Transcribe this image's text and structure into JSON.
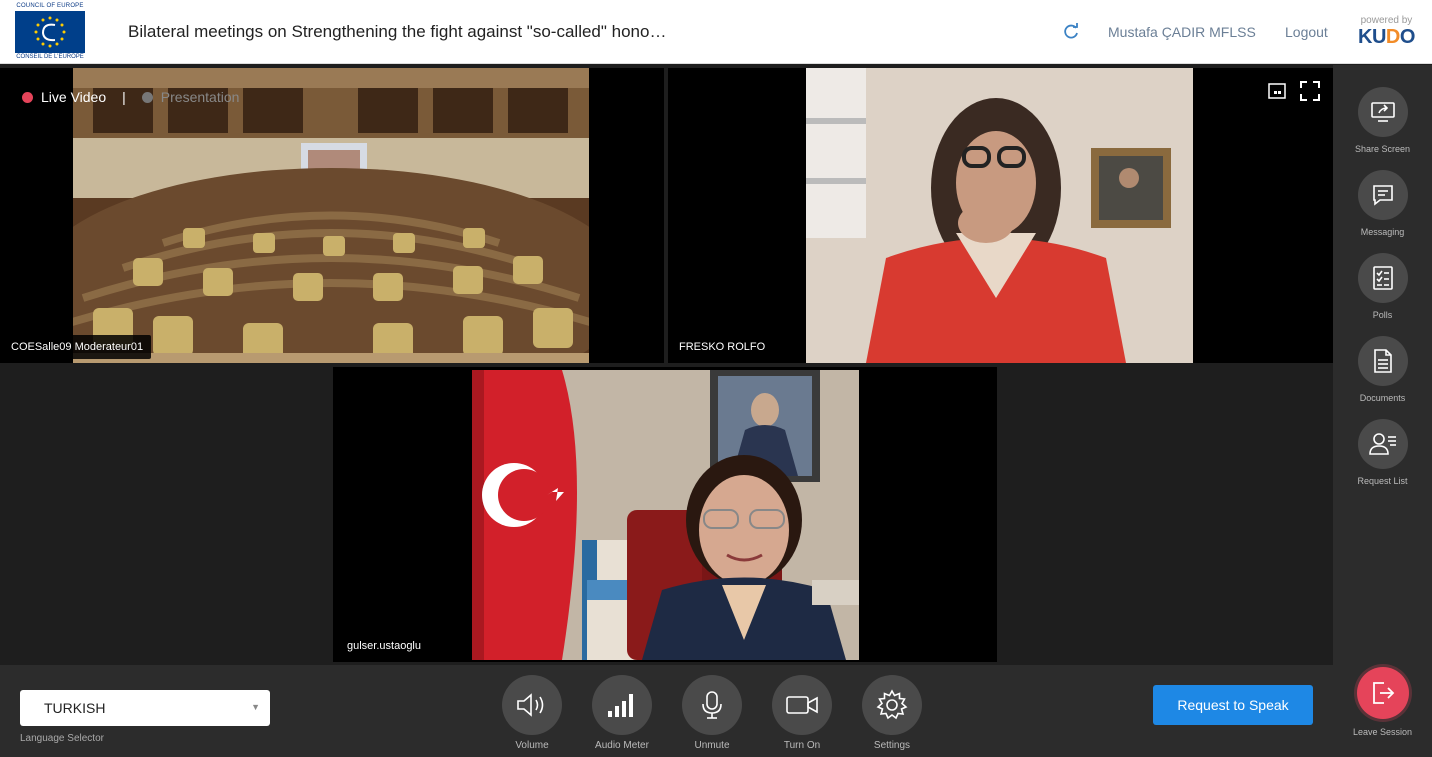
{
  "header": {
    "logo_top": "COUNCIL OF EUROPE",
    "logo_bottom": "CONSEIL DE L'EUROPE",
    "title": "Bilateral meetings on Strengthening the fight against \"so-called\" hono…",
    "refresh_icon": "refresh-icon",
    "user_name": "Mustafa ÇADIR MFLSS",
    "logout": "Logout",
    "powered_by": "powered by",
    "brand": "KUDO"
  },
  "mode_toggle": {
    "live": "Live Video",
    "separator": "|",
    "presentation": "Presentation",
    "live_color": "#e5445a",
    "presentation_color": "#777777"
  },
  "tiles": [
    {
      "label": "COESalle09 Moderateur01"
    },
    {
      "label": "FRESKO ROLFO"
    },
    {
      "label": "gulser.ustaoglu"
    }
  ],
  "sidebar": {
    "items": [
      {
        "label": "Share Screen",
        "icon": "share-screen-icon"
      },
      {
        "label": "Messaging",
        "icon": "messaging-icon"
      },
      {
        "label": "Polls",
        "icon": "polls-icon"
      },
      {
        "label": "Documents",
        "icon": "documents-icon"
      },
      {
        "label": "Request List",
        "icon": "request-list-icon"
      }
    ]
  },
  "bottom": {
    "language_value": "TURKISH",
    "language_label": "Language Selector",
    "controls": [
      {
        "label": "Volume",
        "icon": "volume-icon"
      },
      {
        "label": "Audio Meter",
        "icon": "audio-meter-icon"
      },
      {
        "label": "Unmute",
        "icon": "microphone-icon"
      },
      {
        "label": "Turn On",
        "icon": "camera-icon"
      },
      {
        "label": "Settings",
        "icon": "gear-icon"
      }
    ],
    "request_to_speak": "Request to Speak",
    "leave": "Leave Session"
  },
  "colors": {
    "accent": "#1e88e5",
    "leave": "#e5445a",
    "kudo_blue": "#1f4e8c",
    "kudo_orange": "#f28c28"
  }
}
